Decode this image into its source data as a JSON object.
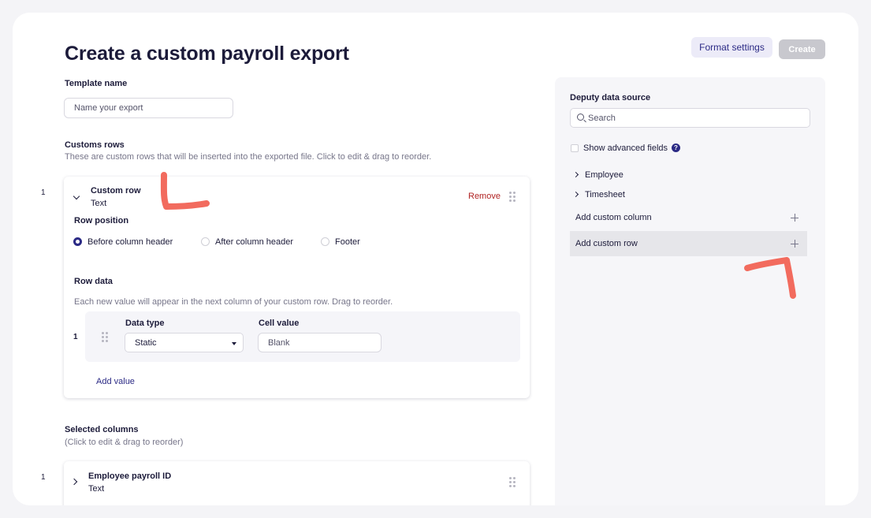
{
  "header": {
    "title": "Create a custom payroll export",
    "format_settings_label": "Format settings",
    "create_label": "Create"
  },
  "template": {
    "label": "Template name",
    "placeholder": "Name your export"
  },
  "custom_rows": {
    "heading": "Customs rows",
    "description": "These are custom rows that will be inserted into the exported file. Click to edit & drag to reorder.",
    "rows": [
      {
        "index": "1",
        "title": "Custom row",
        "type": "Text",
        "remove_label": "Remove",
        "row_position": {
          "label": "Row position",
          "options": [
            "Before column header",
            "After column header",
            "Footer"
          ],
          "selected": "Before column header"
        },
        "row_data": {
          "label": "Row data",
          "description": "Each new value will appear in the next column of your custom row. Drag to reorder.",
          "items": [
            {
              "index": "1",
              "data_type_label": "Data type",
              "data_type_value": "Static",
              "cell_value_label": "Cell value",
              "cell_value_placeholder": "Blank"
            }
          ],
          "add_value_label": "Add value"
        }
      }
    ]
  },
  "selected_columns": {
    "heading": "Selected columns",
    "description": "(Click to edit & drag to reorder)",
    "columns": [
      {
        "index": "1",
        "title": "Employee payroll ID",
        "type": "Text"
      }
    ]
  },
  "sidebar": {
    "heading": "Deputy data source",
    "search_placeholder": "Search",
    "advanced_label": "Show advanced fields",
    "help_glyph": "?",
    "groups": [
      "Employee",
      "Timesheet"
    ],
    "add_custom_column_label": "Add custom column",
    "add_custom_row_label": "Add custom row"
  },
  "colors": {
    "accent": "#2b2a85",
    "remove": "#b12424",
    "annotation": "#f26b5e"
  }
}
